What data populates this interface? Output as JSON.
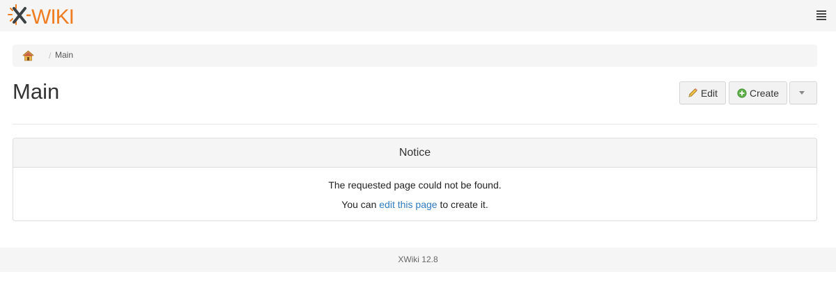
{
  "header": {
    "logo_text": "XWIKI",
    "logo_icon": "xwiki-logo",
    "menu_icon": "hamburger-menu-icon"
  },
  "breadcrumb": {
    "home_icon": "home-icon",
    "separator": "/",
    "current": "Main"
  },
  "page": {
    "title": "Main"
  },
  "actions": {
    "edit_label": "Edit",
    "create_label": "Create",
    "more_icon": "caret-down-icon"
  },
  "notice": {
    "heading": "Notice",
    "message": "The requested page could not be found.",
    "line2_prefix": "You can",
    "line2_link": "edit this page",
    "line2_suffix": "to create it."
  },
  "footer": {
    "version": "XWiki 12.8"
  },
  "colors": {
    "link": "#2f7bbf",
    "logo_orange": "#ef7d22",
    "logo_dark": "#3c4144"
  }
}
